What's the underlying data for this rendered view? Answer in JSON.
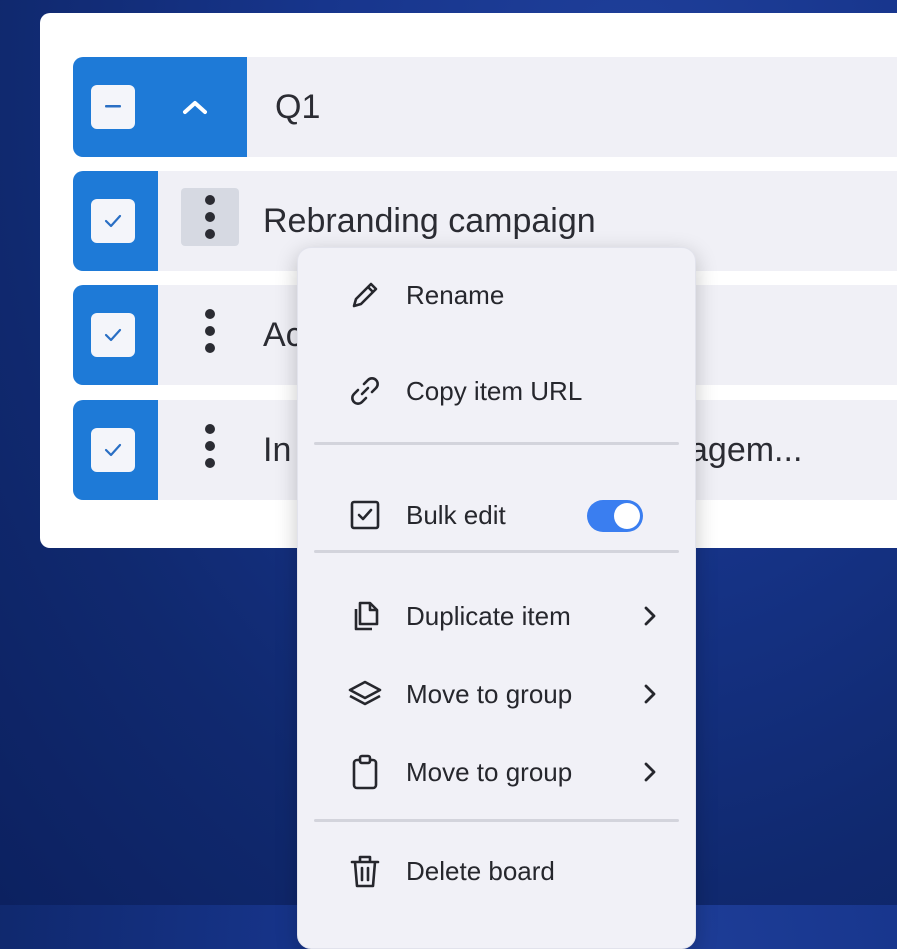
{
  "group": {
    "title": "Q1",
    "checkbox_state": "indeterminate"
  },
  "items": [
    {
      "label": "Rebranding campaign",
      "checked": true
    },
    {
      "label": "Ac",
      "checked": true
    },
    {
      "label": "In",
      "checked": true
    }
  ],
  "items_tail": "agem...",
  "menu": {
    "rename": "Rename",
    "copy_url": "Copy item URL",
    "bulk_edit": "Bulk edit",
    "bulk_edit_enabled": true,
    "duplicate": "Duplicate item",
    "move_group_1": "Move to group",
    "move_group_2": "Move to group",
    "delete_board": "Delete board"
  },
  "colors": {
    "accent": "#1e7ad7",
    "toggle_on": "#3a7ef0"
  }
}
